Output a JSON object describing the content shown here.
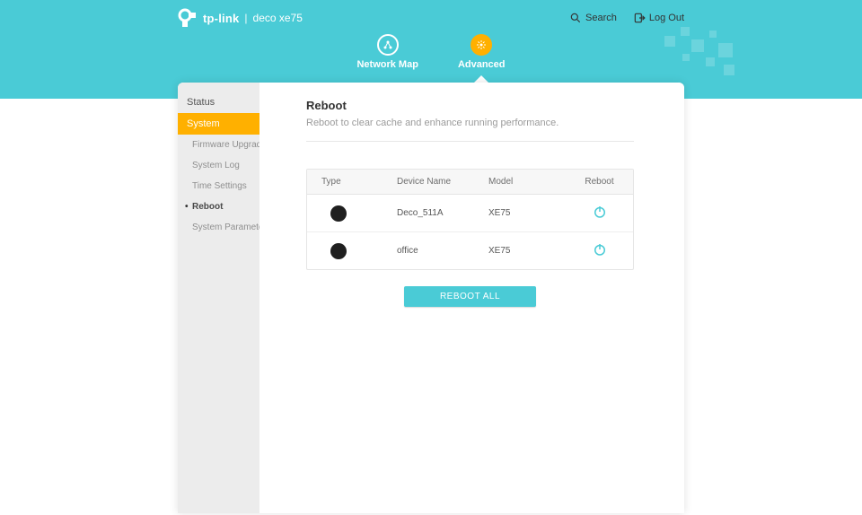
{
  "header": {
    "brand": "tp-link",
    "separator": "|",
    "model": "deco xe75",
    "search_label": "Search",
    "logout_label": "Log Out"
  },
  "nav": {
    "network_map": "Network Map",
    "advanced": "Advanced"
  },
  "sidebar": {
    "status": "Status",
    "system": "System",
    "subitems": {
      "firmware_upgrade": "Firmware Upgrade",
      "system_log": "System Log",
      "time_settings": "Time Settings",
      "reboot": "Reboot",
      "system_parameters": "System Parameters"
    }
  },
  "page": {
    "title": "Reboot",
    "description": "Reboot to clear cache and enhance running performance."
  },
  "table": {
    "headers": {
      "type": "Type",
      "device_name": "Device Name",
      "model": "Model",
      "reboot": "Reboot"
    },
    "rows": [
      {
        "device_name": "Deco_511A",
        "model": "XE75"
      },
      {
        "device_name": "office",
        "model": "XE75"
      }
    ]
  },
  "actions": {
    "reboot_all": "REBOOT ALL"
  }
}
